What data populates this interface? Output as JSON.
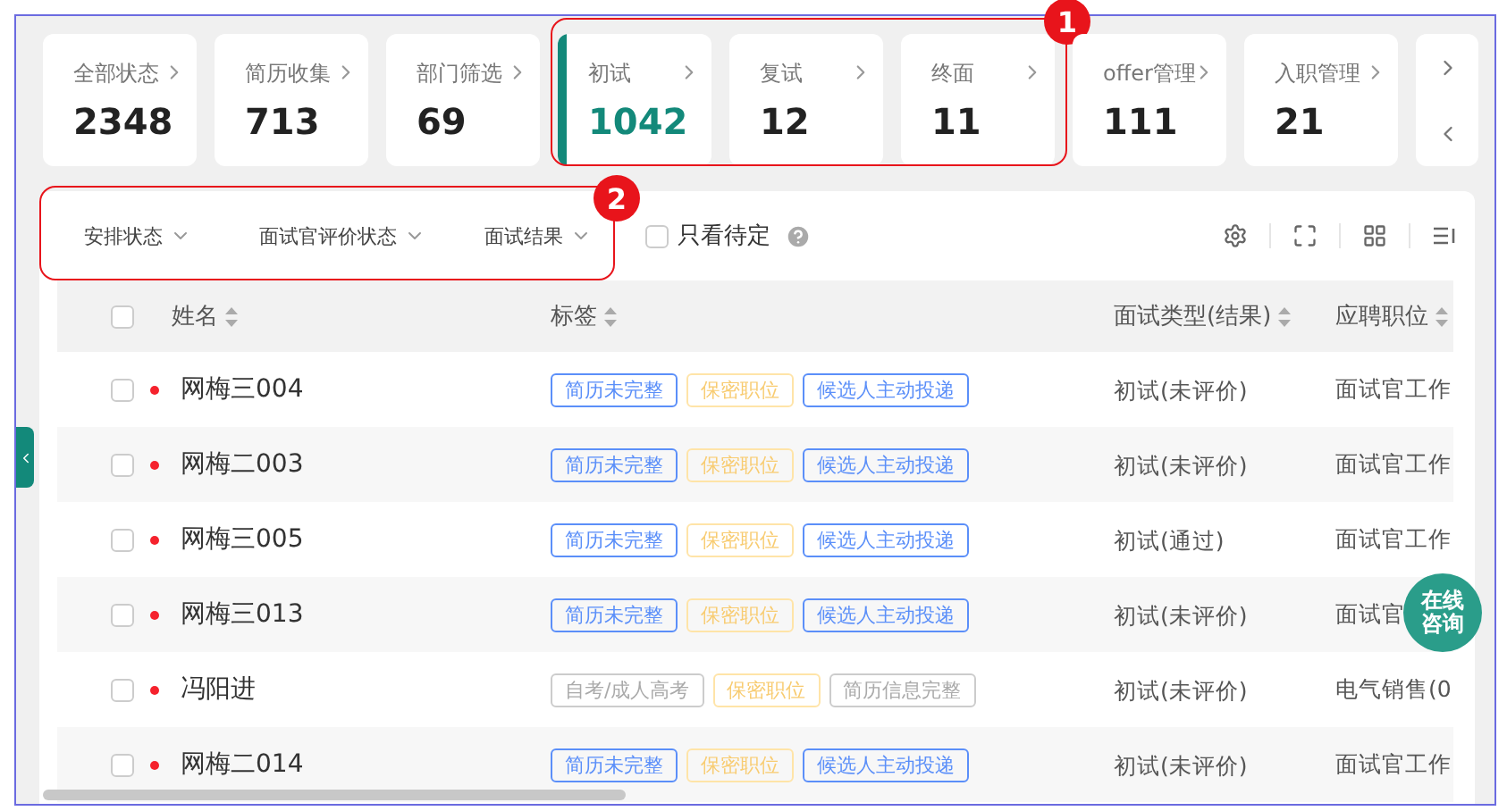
{
  "stat_cards": [
    {
      "label": "全部状态",
      "count": "2348",
      "selected": false,
      "annotated": false
    },
    {
      "label": "简历收集",
      "count": "713",
      "selected": false,
      "annotated": false
    },
    {
      "label": "部门筛选",
      "count": "69",
      "selected": false,
      "annotated": false
    },
    {
      "label": "初试",
      "count": "1042",
      "selected": true,
      "annotated": true
    },
    {
      "label": "复试",
      "count": "12",
      "selected": false,
      "annotated": true
    },
    {
      "label": "终面",
      "count": "11",
      "selected": false,
      "annotated": true
    },
    {
      "label": "offer管理",
      "count": "111",
      "selected": false,
      "annotated": false
    },
    {
      "label": "入职管理",
      "count": "21",
      "selected": false,
      "annotated": false
    }
  ],
  "annotations": [
    "1",
    "2"
  ],
  "filters": {
    "annotated": true,
    "dropdowns": [
      "安排状态",
      "面试官评价状态",
      "面试结果"
    ],
    "pending_only": {
      "label": "只看待定",
      "checked": false
    }
  },
  "table": {
    "header_checked": false,
    "columns": [
      "姓名",
      "标签",
      "面试类型(结果)",
      "应聘职位"
    ],
    "rows": [
      {
        "checked": false,
        "name": "网梅三004",
        "tags": [
          {
            "text": "简历未完整",
            "kind": "blue"
          },
          {
            "text": "保密职位",
            "kind": "yellow"
          },
          {
            "text": "候选人主动投递",
            "kind": "blue"
          }
        ],
        "interview_type": "初试(未评价)",
        "position": "面试官工作"
      },
      {
        "checked": false,
        "name": "网梅二003",
        "tags": [
          {
            "text": "简历未完整",
            "kind": "blue"
          },
          {
            "text": "保密职位",
            "kind": "yellow"
          },
          {
            "text": "候选人主动投递",
            "kind": "blue"
          }
        ],
        "interview_type": "初试(未评价)",
        "position": "面试官工作"
      },
      {
        "checked": false,
        "name": "网梅三005",
        "tags": [
          {
            "text": "简历未完整",
            "kind": "blue"
          },
          {
            "text": "保密职位",
            "kind": "yellow"
          },
          {
            "text": "候选人主动投递",
            "kind": "blue"
          }
        ],
        "interview_type": "初试(通过)",
        "position": "面试官工作"
      },
      {
        "checked": false,
        "name": "网梅三013",
        "tags": [
          {
            "text": "简历未完整",
            "kind": "blue"
          },
          {
            "text": "保密职位",
            "kind": "yellow"
          },
          {
            "text": "候选人主动投递",
            "kind": "blue"
          }
        ],
        "interview_type": "初试(未评价)",
        "position": "面试官"
      },
      {
        "checked": false,
        "name": "冯阳进",
        "tags": [
          {
            "text": "自考/成人高考",
            "kind": "grey"
          },
          {
            "text": "保密职位",
            "kind": "yellow"
          },
          {
            "text": "简历信息完整",
            "kind": "grey"
          }
        ],
        "interview_type": "初试(未评价)",
        "position": "电气销售(0"
      },
      {
        "checked": false,
        "name": "网梅二014",
        "tags": [
          {
            "text": "简历未完整",
            "kind": "blue"
          },
          {
            "text": "保密职位",
            "kind": "yellow"
          },
          {
            "text": "候选人主动投递",
            "kind": "blue"
          }
        ],
        "interview_type": "初试(未评价)",
        "position": "面试官工作"
      }
    ]
  },
  "chat_button": "在线咨询"
}
